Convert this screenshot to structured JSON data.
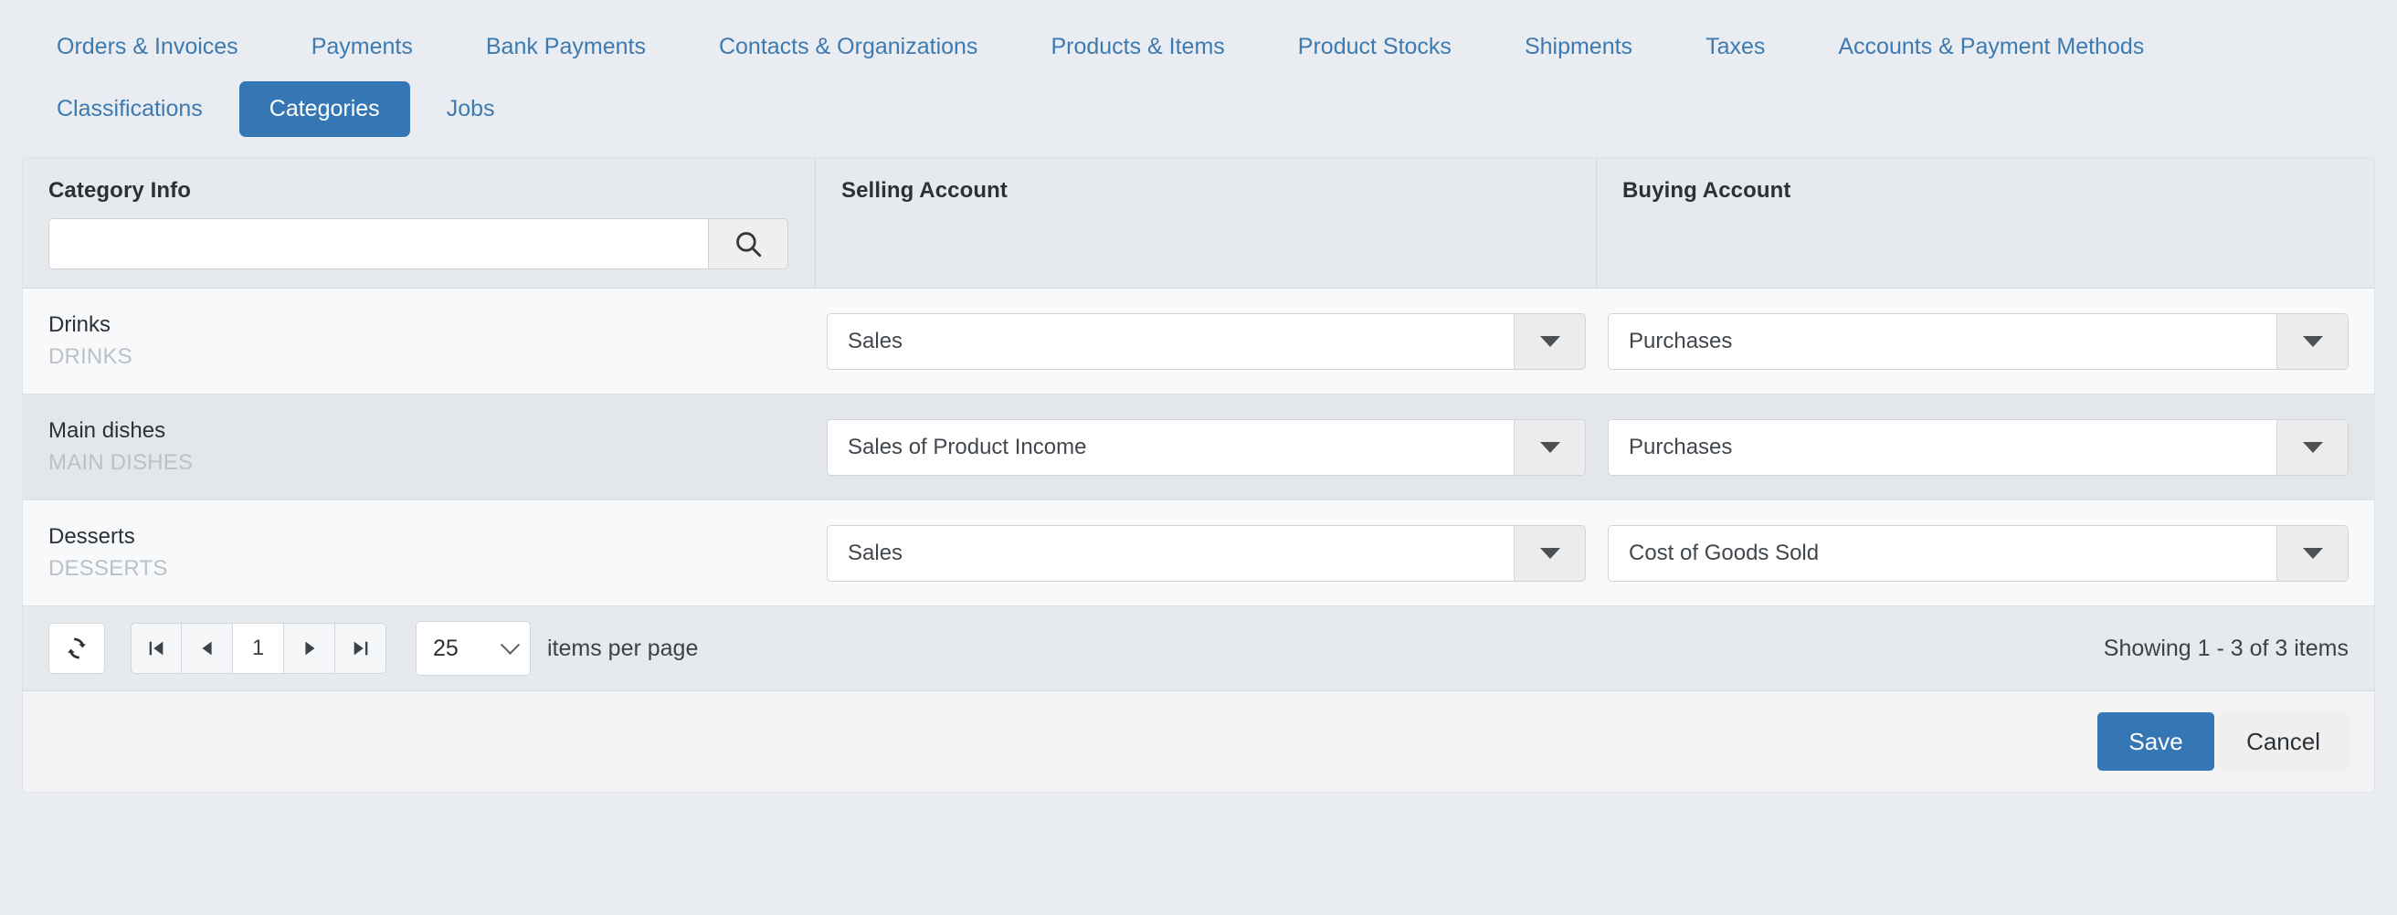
{
  "nav": {
    "row1": [
      {
        "label": "Orders & Invoices",
        "active": false
      },
      {
        "label": "Payments",
        "active": false
      },
      {
        "label": "Bank Payments",
        "active": false
      },
      {
        "label": "Contacts & Organizations",
        "active": false
      },
      {
        "label": "Products & Items",
        "active": false
      },
      {
        "label": "Product Stocks",
        "active": false
      },
      {
        "label": "Shipments",
        "active": false
      },
      {
        "label": "Taxes",
        "active": false
      },
      {
        "label": "Accounts & Payment Methods",
        "active": false
      }
    ],
    "row2": [
      {
        "label": "Classifications",
        "active": false
      },
      {
        "label": "Categories",
        "active": true
      },
      {
        "label": "Jobs",
        "active": false
      }
    ]
  },
  "grid": {
    "headers": {
      "category": "Category Info",
      "selling": "Selling Account",
      "buying": "Buying Account"
    },
    "search": {
      "value": "",
      "placeholder": "",
      "icon": "search-icon"
    },
    "rows": [
      {
        "name": "Drinks",
        "code": "DRINKS",
        "selling_account": "Sales",
        "buying_account": "Purchases"
      },
      {
        "name": "Main dishes",
        "code": "MAIN DISHES",
        "selling_account": "Sales of Product Income",
        "buying_account": "Purchases"
      },
      {
        "name": "Desserts",
        "code": "DESSERTS",
        "selling_account": "Sales",
        "buying_account": "Cost of Goods Sold"
      }
    ]
  },
  "pager": {
    "refresh_icon": "refresh-icon",
    "first_icon": "first-page-icon",
    "prev_icon": "previous-page-icon",
    "current_page": "1",
    "next_icon": "next-page-icon",
    "last_icon": "last-page-icon",
    "page_size": "25",
    "page_size_label": "items per page",
    "showing": "Showing 1 - 3 of 3 items"
  },
  "footer": {
    "save_label": "Save",
    "cancel_label": "Cancel"
  },
  "colors": {
    "accent": "#3577b5",
    "page_bg": "#e9ecf1",
    "row_odd": "#f8f9fa",
    "row_even": "#e3e7ec",
    "header_bg": "#e6eaef",
    "link": "#3d7ab0",
    "muted_text": "#bcc1c6"
  }
}
